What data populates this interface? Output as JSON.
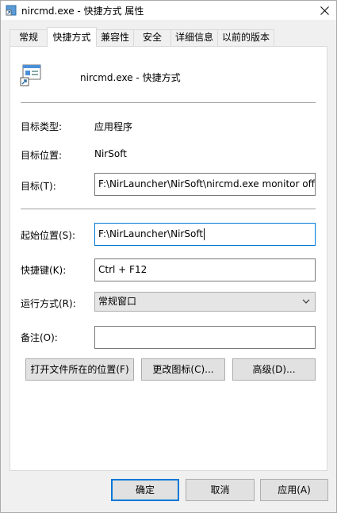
{
  "window": {
    "title": "nircmd.exe - 快捷方式 属性"
  },
  "tabs": [
    {
      "label": "常规"
    },
    {
      "label": "快捷方式"
    },
    {
      "label": "兼容性"
    },
    {
      "label": "安全"
    },
    {
      "label": "详细信息"
    },
    {
      "label": "以前的版本"
    }
  ],
  "shortcut": {
    "name": "nircmd.exe - 快捷方式",
    "target_type_label": "目标类型:",
    "target_type_value": "应用程序",
    "target_location_label": "目标位置:",
    "target_location_value": "NirSoft",
    "target_label": "目标(T):",
    "target_value": "F:\\NirLauncher\\NirSoft\\nircmd.exe monitor off",
    "start_in_label": "起始位置(S):",
    "start_in_value": "F:\\NirLauncher\\NirSoft",
    "hotkey_label": "快捷键(K):",
    "hotkey_value": "Ctrl + F12",
    "run_label": "运行方式(R):",
    "run_value": "常规窗口",
    "comment_label": "备注(O):",
    "comment_value": ""
  },
  "actions": {
    "open_location": "打开文件所在的位置(F)",
    "change_icon": "更改图标(C)...",
    "advanced": "高级(D)..."
  },
  "footer": {
    "ok": "确定",
    "cancel": "取消",
    "apply": "应用(A)"
  }
}
